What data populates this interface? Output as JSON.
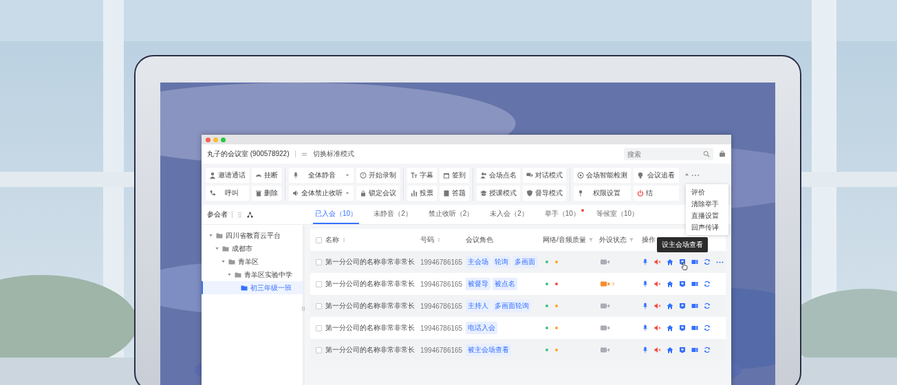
{
  "window": {
    "title": "丸子的会议室 (900578922)",
    "mode_switch": "切换标准模式",
    "search": {
      "placeholder": "搜索"
    }
  },
  "toolbar": {
    "groups": [
      {
        "buttons": [
          {
            "label": "邀请通话",
            "kind": "plain"
          },
          {
            "label": "挂断",
            "kind": "plain"
          },
          {
            "label": "呼叫",
            "kind": "plain"
          },
          {
            "label": "删除",
            "kind": "plain"
          }
        ]
      },
      {
        "buttons": [
          {
            "label": "全体静音",
            "kind": "dropdown"
          },
          {
            "label": "开始录制",
            "kind": "plain"
          },
          {
            "label": "全体禁止收听",
            "kind": "dropdown"
          },
          {
            "label": "锁定会议",
            "kind": "plain"
          }
        ]
      },
      {
        "buttons": [
          {
            "label": "字幕",
            "kind": "plain"
          },
          {
            "label": "签到",
            "kind": "plain"
          },
          {
            "label": "投票",
            "kind": "plain"
          },
          {
            "label": "答题",
            "kind": "plain"
          }
        ]
      },
      {
        "buttons": [
          {
            "label": "会场点名",
            "kind": "plain"
          },
          {
            "label": "对话模式",
            "kind": "plain"
          },
          {
            "label": "授课模式",
            "kind": "plain"
          },
          {
            "label": "督导模式",
            "kind": "plain"
          }
        ]
      },
      {
        "buttons": [
          {
            "label": "会场智能检测",
            "kind": "plain"
          },
          {
            "label": "会议追看",
            "kind": "plain"
          },
          {
            "label": "权限设置",
            "kind": "plain"
          },
          {
            "label": "结",
            "kind": "danger"
          }
        ]
      }
    ]
  },
  "more_menu": {
    "items": [
      "评价",
      "清除举手",
      "直播设置",
      "回声传译"
    ]
  },
  "sidebar": {
    "title": "参会者",
    "tree": [
      {
        "label": "四川省教育云平台",
        "expanded": true,
        "selected": false,
        "children": [
          {
            "label": "成都市",
            "expanded": true,
            "selected": false,
            "children": [
              {
                "label": "青羊区",
                "expanded": true,
                "selected": false,
                "children": [
                  {
                    "label": "青羊区实验中学",
                    "expanded": true,
                    "selected": false,
                    "children": [
                      {
                        "label": "初三年级一班",
                        "selected": true
                      }
                    ]
                  }
                ]
              }
            ]
          }
        ]
      }
    ]
  },
  "tabs": [
    {
      "label": "已入会（10）",
      "selected": true,
      "dot": false
    },
    {
      "label": "未静音（2）",
      "selected": false,
      "dot": false
    },
    {
      "label": "禁止收听（2）",
      "selected": false,
      "dot": false
    },
    {
      "label": "未入会（2）",
      "selected": false,
      "dot": false
    },
    {
      "label": "举手（10）",
      "selected": false,
      "dot": true
    },
    {
      "label": "等候室（10）",
      "selected": false,
      "dot": false
    }
  ],
  "table": {
    "header_checked": false,
    "columns": [
      {
        "label": "名称",
        "kind": "sort"
      },
      {
        "label": "号码",
        "kind": "sort"
      },
      {
        "label": "会议角色",
        "kind": "plain"
      },
      {
        "label": "网络/音频质量",
        "kind": "filter"
      },
      {
        "label": "外设状态",
        "kind": "filter"
      },
      {
        "label": "操作",
        "kind": "plain"
      }
    ],
    "rows": [
      {
        "checked": false,
        "name": "第一分公司的名称非常非常长",
        "number": "19946786165",
        "roles": [
          "主会场",
          "轮询",
          "多画面"
        ],
        "quality": [
          {
            "color": "#3cc28a"
          },
          {
            "color": "#f5a623"
          }
        ],
        "camera": {
          "color": "#a9acb3"
        },
        "more": true,
        "tooltip": "设主会场查看"
      },
      {
        "checked": false,
        "name": "第一分公司的名称非常非常长",
        "number": "19946786165",
        "roles": [
          "被督导",
          "被点名"
        ],
        "quality": [
          {
            "color": "#3cc28a"
          },
          {
            "color": "#f5453d"
          }
        ],
        "camera": {
          "color": "#fa8c2e",
          "note": "?"
        },
        "more": false
      },
      {
        "checked": false,
        "name": "第一分公司的名称非常非常长",
        "number": "19946786165",
        "roles": [
          "主持人",
          "多画面轮询"
        ],
        "quality": [
          {
            "color": "#3cc28a"
          },
          {
            "color": "#f5a623"
          }
        ],
        "camera": {
          "color": "#a9acb3"
        },
        "more": false
      },
      {
        "checked": false,
        "name": "第一分公司的名称非常非常长",
        "number": "19946786165",
        "roles": [
          "电话入会"
        ],
        "quality": [
          {
            "color": "#3cc28a"
          },
          {
            "color": "#f5a623"
          }
        ],
        "camera": {
          "color": "#a9acb3"
        },
        "more": false
      },
      {
        "checked": false,
        "name": "第一分公司的名称非常非常长",
        "number": "19946786165",
        "roles": [
          "被主会场查看"
        ],
        "quality": [
          {
            "color": "#3cc28a"
          },
          {
            "color": "#f5a623"
          }
        ],
        "camera": {
          "color": "#a9acb3"
        },
        "more": false
      }
    ]
  }
}
